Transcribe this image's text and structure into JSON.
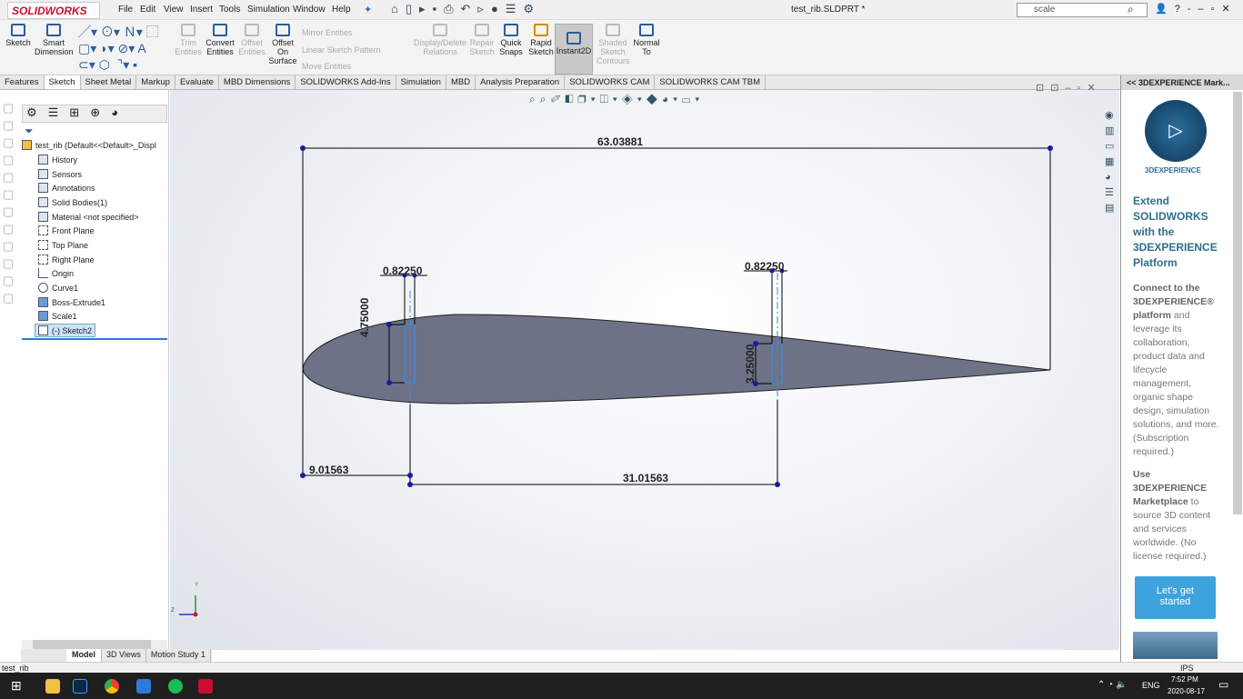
{
  "app": {
    "logo": "SOLIDWORKS",
    "title": "test_rib.SLDPRT *",
    "menu": [
      "File",
      "Edit",
      "View",
      "Insert",
      "Tools",
      "Simulation",
      "Window",
      "Help"
    ],
    "search_placeholder": "scale"
  },
  "commands": [
    {
      "label": "Sketch",
      "enabled": true
    },
    {
      "label": "Smart Dimension",
      "enabled": true
    },
    {
      "label": "Trim Entities",
      "enabled": false
    },
    {
      "label": "Convert Entities",
      "enabled": true
    },
    {
      "label": "Offset Entities",
      "enabled": false
    },
    {
      "label": "Offset On Surface",
      "enabled": true
    },
    {
      "label": "Display/Delete Relations",
      "enabled": false
    },
    {
      "label": "Repair Sketch",
      "enabled": false
    },
    {
      "label": "Quick Snaps",
      "enabled": true
    },
    {
      "label": "Rapid Sketch",
      "enabled": true
    },
    {
      "label": "Instant2D",
      "enabled": true,
      "active": true
    },
    {
      "label": "Shaded Sketch Contours",
      "enabled": false
    },
    {
      "label": "Normal To",
      "enabled": true
    }
  ],
  "small_commands": [
    "Mirror Entities",
    "Linear Sketch Pattern",
    "Move Entities"
  ],
  "tabs": [
    "Features",
    "Sketch",
    "Sheet Metal",
    "Markup",
    "Evaluate",
    "MBD Dimensions",
    "SOLIDWORKS Add-Ins",
    "Simulation",
    "MBD",
    "Analysis Preparation",
    "SOLIDWORKS CAM",
    "SOLIDWORKS CAM TBM"
  ],
  "active_tab": "Sketch",
  "tree": {
    "root": "test_rib  (Default<<Default>_Displ",
    "items": [
      "History",
      "Sensors",
      "Annotations",
      "Solid Bodies(1)",
      "Material <not specified>",
      "Front Plane",
      "Top Plane",
      "Right Plane",
      "Origin",
      "Curve1",
      "Boss-Extrude1",
      "Scale1",
      "(-) Sketch2"
    ],
    "selected": "(-) Sketch2"
  },
  "dimensions": {
    "overall": "63.03881",
    "width_left": "0.82250",
    "width_right": "0.82250",
    "height_left": "4.75000",
    "height_right": "3.25000",
    "offset_left": "9.01563",
    "spacing": "31.01563"
  },
  "triad": {
    "y": "Y",
    "z": "Z"
  },
  "bottom_tabs": [
    "Model",
    "3D Views",
    "Motion Study 1"
  ],
  "right_panel": {
    "header": "<< 3DEXPERIENCE Mark...",
    "logo_text": "3DEXPERIENCE",
    "heading": "Extend SOLIDWORKS with the 3DEXPERIENCE Platform",
    "p1_bold": "Connect to the 3DEXPERIENCE® platform",
    "p1": " and leverage its collaboration, product data and lifecycle management, organic shape design, simulation solutions, and more. (Subscription required.)",
    "p2_bold": "Use 3DEXPERIENCE Marketplace",
    "p2": " to source 3D content and services worldwide. (No license required.)",
    "button": "Let's get started"
  },
  "status": {
    "left": "test_rib",
    "units": "IPS"
  },
  "taskbar": {
    "lang": "ENG",
    "time": "7:52 PM",
    "date": "2020-08-17"
  },
  "colors": {
    "airfoil": "#6d7286",
    "dimension": "#000000",
    "construction": "#3a8ee6",
    "accent": "#1e6fb5"
  }
}
